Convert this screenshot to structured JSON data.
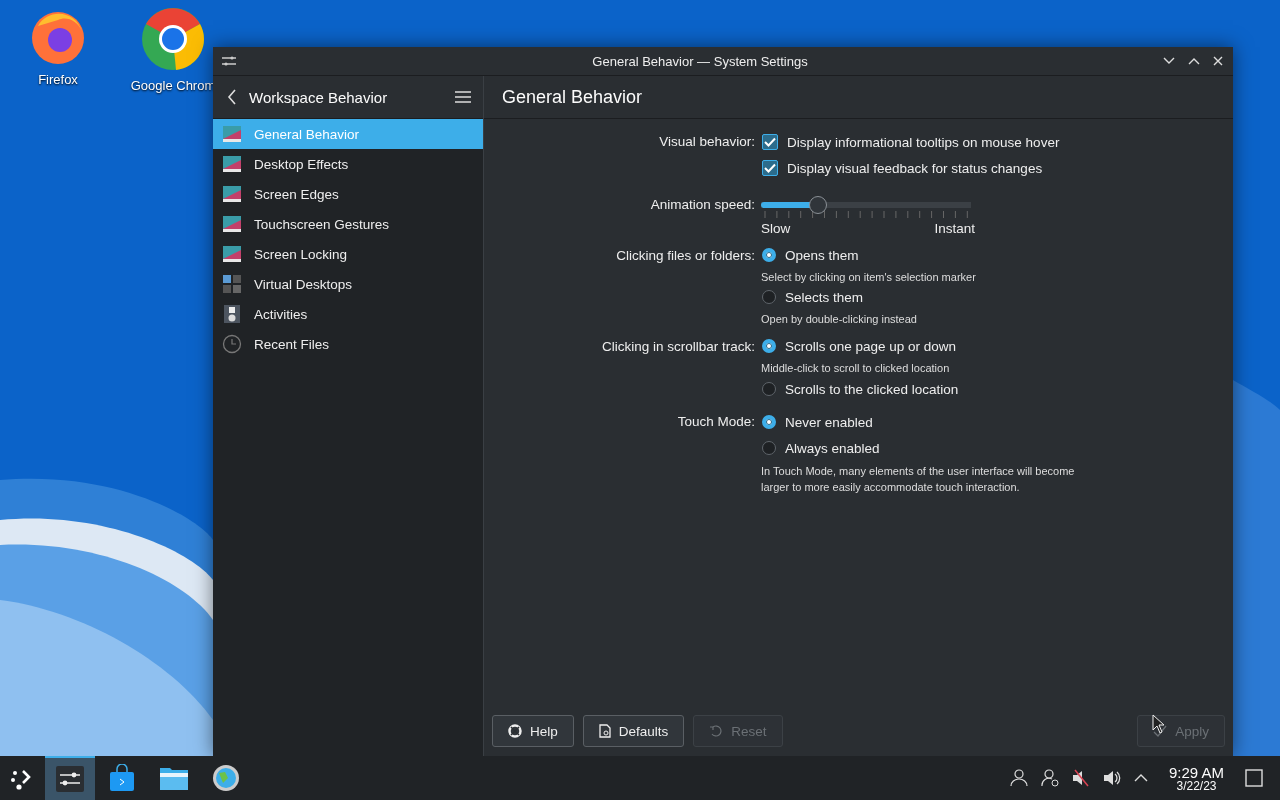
{
  "desktop_icons": [
    {
      "label": "Firefox",
      "kind": "firefox"
    },
    {
      "label": "Google Chrom",
      "kind": "chrome"
    }
  ],
  "window": {
    "title": "General Behavior — System Settings",
    "sidebar": {
      "title": "Workspace Behavior",
      "items": [
        {
          "label": "General Behavior",
          "selected": true,
          "kind": "sliders"
        },
        {
          "label": "Desktop Effects",
          "selected": false,
          "kind": "wand"
        },
        {
          "label": "Screen Edges",
          "selected": false,
          "kind": "screen"
        },
        {
          "label": "Touchscreen Gestures",
          "selected": false,
          "kind": "hand"
        },
        {
          "label": "Screen Locking",
          "selected": false,
          "kind": "lock"
        },
        {
          "label": "Virtual Desktops",
          "selected": false,
          "kind": "grid"
        },
        {
          "label": "Activities",
          "selected": false,
          "kind": "activities"
        },
        {
          "label": "Recent Files",
          "selected": false,
          "kind": "clock"
        }
      ]
    },
    "page": {
      "title": "General Behavior",
      "settings": [
        {
          "kind": "checks",
          "label": "Visual behavior:",
          "options": [
            {
              "label": "Display informational tooltips on mouse hover",
              "checked": true
            },
            {
              "label": "Display visual feedback for status changes",
              "checked": true
            }
          ]
        },
        {
          "kind": "slider",
          "label": "Animation speed:",
          "level": 0.27,
          "min_label": "Slow",
          "max_label": "Instant"
        },
        {
          "kind": "radios",
          "label": "Clicking files or folders:",
          "options": [
            {
              "label": "Opens them",
              "selected": true,
              "hint": "Select by clicking on item's selection marker"
            },
            {
              "label": "Selects them",
              "selected": false,
              "hint": "Open by double-clicking instead"
            }
          ]
        },
        {
          "kind": "radios",
          "label": "Clicking in scrollbar track:",
          "options": [
            {
              "label": "Scrolls one page up or down",
              "selected": true,
              "hint": "Middle-click to scroll to clicked location"
            },
            {
              "label": "Scrolls to the clicked location",
              "selected": false
            }
          ]
        },
        {
          "kind": "radios",
          "label": "Touch Mode:",
          "options": [
            {
              "label": "Never enabled",
              "selected": true
            },
            {
              "label": "Always enabled",
              "selected": false
            }
          ],
          "note": "In Touch Mode, many elements of the user interface will become larger to more easily accommodate touch interaction."
        }
      ]
    },
    "buttons": [
      {
        "label": "Help",
        "kind": "help",
        "disabled": false
      },
      {
        "label": "Defaults",
        "kind": "defaults",
        "disabled": false
      },
      {
        "label": "Reset",
        "kind": "reset",
        "disabled": true
      },
      {
        "label": "Apply",
        "kind": "apply",
        "disabled": true
      }
    ]
  },
  "taskbar": {
    "apps": [
      {
        "kind": "settings",
        "selected": true
      },
      {
        "kind": "store",
        "selected": false
      },
      {
        "kind": "folder",
        "selected": false
      },
      {
        "kind": "globe",
        "selected": false
      }
    ],
    "clock": {
      "time": "9:29 AM",
      "date": "3/22/23"
    }
  }
}
